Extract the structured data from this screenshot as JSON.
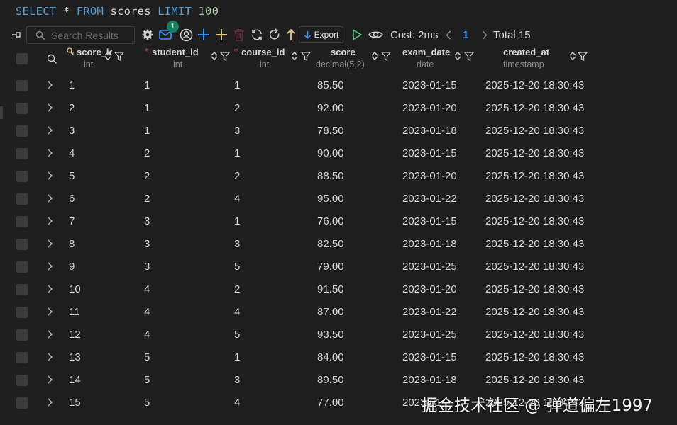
{
  "editor": {
    "sql_select": "SELECT",
    "sql_star": "*",
    "sql_from": "FROM",
    "sql_table": "scores",
    "sql_limit": "LIMIT",
    "sql_limit_value": "100"
  },
  "toolbar": {
    "search_placeholder": "Search Results",
    "notification_count": "1",
    "export_label": "Export",
    "cost_label": "Cost: 2ms",
    "page_number": "1",
    "total_label": "Total 15",
    "icons": [
      "pin-icon",
      "search-icon",
      "gear-icon",
      "mail-icon",
      "user-circle-icon",
      "plus-icon",
      "add-row-icon",
      "delete-icon",
      "sync-icon",
      "refresh-icon",
      "arrow-up-icon",
      "download-icon",
      "run-icon",
      "eye-icon",
      "chevron-left-icon",
      "chevron-right-icon"
    ],
    "colors": {
      "plus": "#3794ff",
      "add_row": "#e2c08d",
      "delete": "#6b3333",
      "run": "#4ec97b",
      "arrow_up": "#e2c08d",
      "badge": "#16825d"
    }
  },
  "columns": [
    {
      "name": "score_id",
      "display": "score_ic",
      "type": "int",
      "key": true,
      "required": false
    },
    {
      "name": "student_id",
      "display": "student_id",
      "type": "int",
      "key": false,
      "required": true
    },
    {
      "name": "course_id",
      "display": "course_id",
      "type": "int",
      "key": false,
      "required": true
    },
    {
      "name": "score",
      "display": "score",
      "type": "decimal(5,2)",
      "key": false,
      "required": false
    },
    {
      "name": "exam_date",
      "display": "exam_date",
      "type": "date",
      "key": false,
      "required": false
    },
    {
      "name": "created_at",
      "display": "created_at",
      "type": "timestamp",
      "key": false,
      "required": false
    }
  ],
  "rows": [
    [
      "1",
      "1",
      "1",
      "85.50",
      "2023-01-15",
      "2025-12-20 18:30:43"
    ],
    [
      "2",
      "1",
      "2",
      "92.00",
      "2023-01-20",
      "2025-12-20 18:30:43"
    ],
    [
      "3",
      "1",
      "3",
      "78.50",
      "2023-01-18",
      "2025-12-20 18:30:43"
    ],
    [
      "4",
      "2",
      "1",
      "90.00",
      "2023-01-15",
      "2025-12-20 18:30:43"
    ],
    [
      "5",
      "2",
      "2",
      "88.50",
      "2023-01-20",
      "2025-12-20 18:30:43"
    ],
    [
      "6",
      "2",
      "4",
      "95.00",
      "2023-01-22",
      "2025-12-20 18:30:43"
    ],
    [
      "7",
      "3",
      "1",
      "76.00",
      "2023-01-15",
      "2025-12-20 18:30:43"
    ],
    [
      "8",
      "3",
      "3",
      "82.50",
      "2023-01-18",
      "2025-12-20 18:30:43"
    ],
    [
      "9",
      "3",
      "5",
      "79.00",
      "2023-01-25",
      "2025-12-20 18:30:43"
    ],
    [
      "10",
      "4",
      "2",
      "91.50",
      "2023-01-20",
      "2025-12-20 18:30:43"
    ],
    [
      "11",
      "4",
      "4",
      "87.00",
      "2023-01-22",
      "2025-12-20 18:30:43"
    ],
    [
      "12",
      "4",
      "5",
      "93.50",
      "2023-01-25",
      "2025-12-20 18:30:43"
    ],
    [
      "13",
      "5",
      "1",
      "84.00",
      "2023-01-15",
      "2025-12-20 18:30:43"
    ],
    [
      "14",
      "5",
      "3",
      "89.50",
      "2023-01-18",
      "2025-12-20 18:30:43"
    ],
    [
      "15",
      "5",
      "4",
      "77.00",
      "2023-01-",
      "2025-12-20 18:30:43"
    ]
  ],
  "watermark": "掘金技术社区 @ 弹道偏左1997"
}
